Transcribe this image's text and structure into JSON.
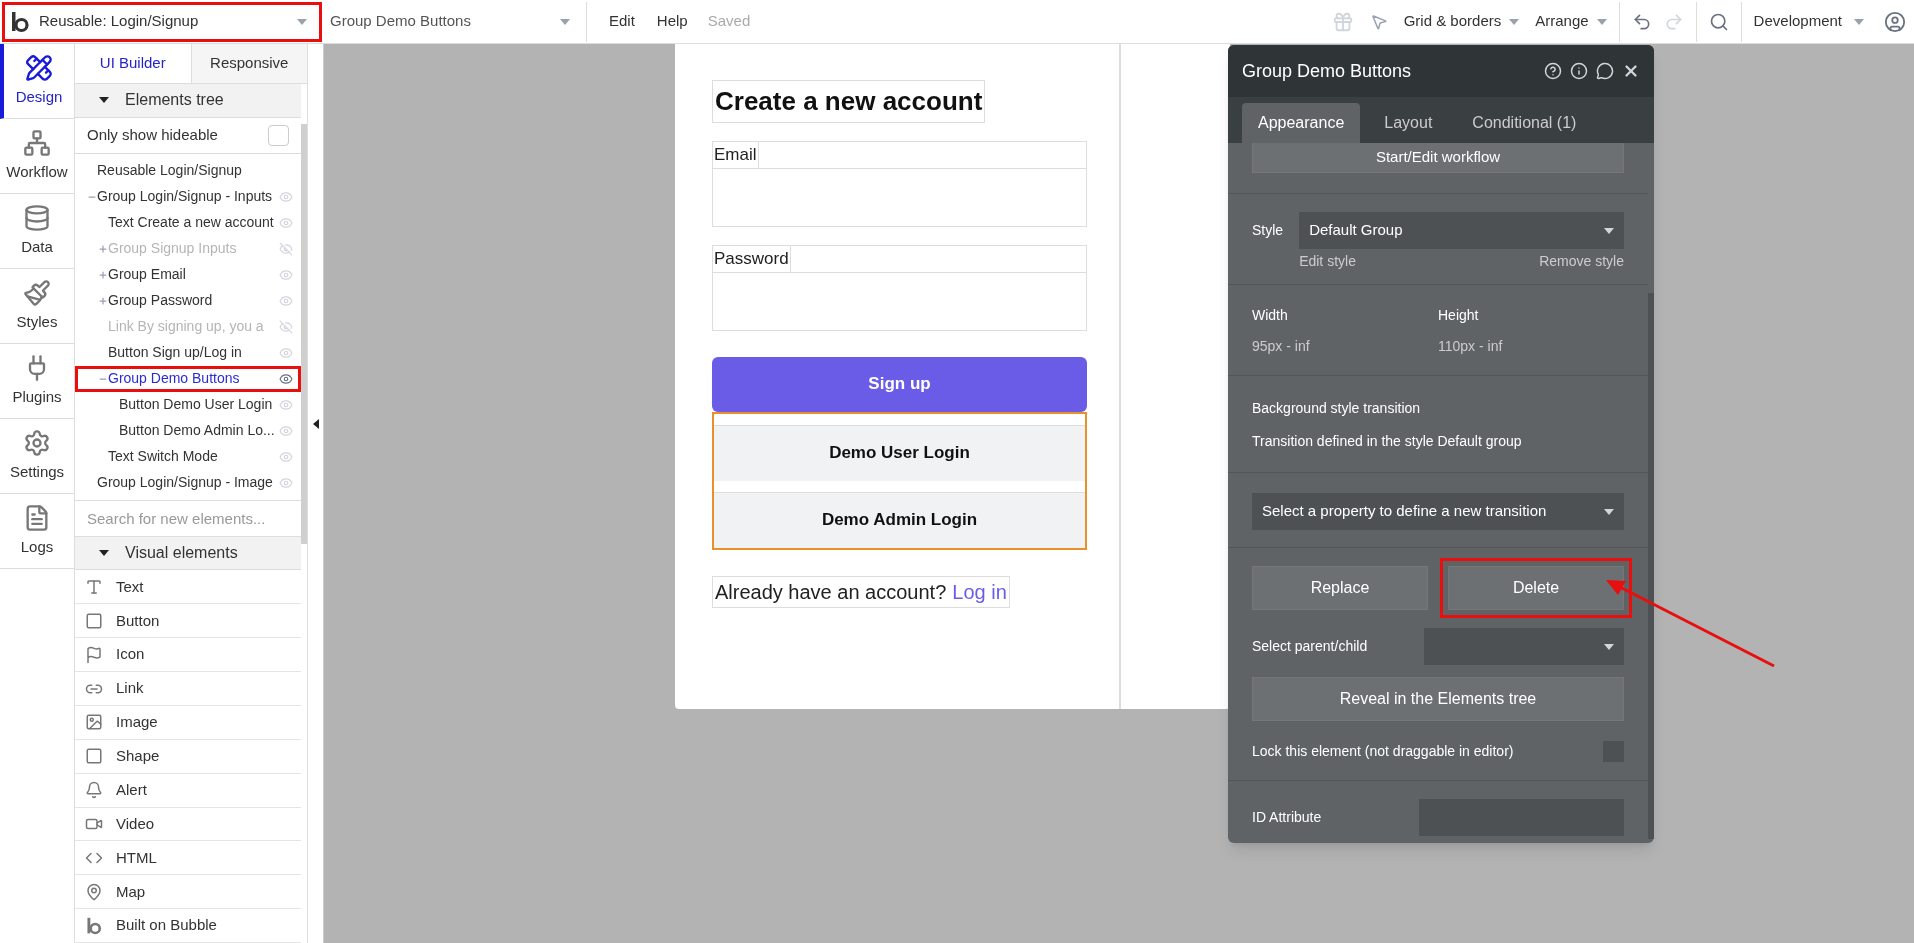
{
  "top_bar": {
    "page_select": {
      "value": "Reusable: Login/Signup",
      "highlighted": true
    },
    "element_select": {
      "value": "Group Demo Buttons"
    },
    "menu": [
      {
        "label": "Edit"
      },
      {
        "label": "Help"
      }
    ],
    "save_status": "Saved",
    "grid_menu": "Grid & borders",
    "arrange_menu": "Arrange",
    "environment": "Development"
  },
  "nav": [
    {
      "label": "Design",
      "selected": true
    },
    {
      "label": "Workflow",
      "selected": false
    },
    {
      "label": "Data",
      "selected": false
    },
    {
      "label": "Styles",
      "selected": false
    },
    {
      "label": "Plugins",
      "selected": false
    },
    {
      "label": "Settings",
      "selected": false
    },
    {
      "label": "Logs",
      "selected": false
    }
  ],
  "panel_tabs": [
    {
      "label": "UI Builder",
      "selected": true
    },
    {
      "label": "Responsive",
      "selected": false
    }
  ],
  "elements_tree": {
    "title": "Elements tree",
    "expanded": true,
    "filter": {
      "label": "Only show hideable",
      "checked": false
    },
    "items": [
      {
        "label": "Reusable Login/Signup",
        "kind": "root",
        "hidden": false,
        "selected": false,
        "highlighted": false
      },
      {
        "label": "Group Login/Signup - Inputs",
        "kind": "element",
        "hidden": false,
        "selected": false,
        "highlighted": false,
        "expanded": true,
        "children": [
          {
            "label": "Text Create a new account",
            "kind": "element",
            "hidden": false,
            "selected": false,
            "highlighted": false
          },
          {
            "label": "Group Signup Inputs",
            "kind": "element",
            "hidden": true,
            "selected": false,
            "highlighted": false,
            "expanded": false
          },
          {
            "label": "Group Email",
            "kind": "element",
            "hidden": false,
            "selected": false,
            "highlighted": false,
            "expanded": false
          },
          {
            "label": "Group Password",
            "kind": "element",
            "hidden": false,
            "selected": false,
            "highlighted": false,
            "expanded": false
          },
          {
            "label": "Link By signing up, you a",
            "kind": "element",
            "hidden": true,
            "selected": false,
            "highlighted": false
          },
          {
            "label": "Button Sign up/Log in",
            "kind": "element",
            "hidden": false,
            "selected": false,
            "highlighted": false
          },
          {
            "label": "Group Demo Buttons",
            "kind": "element",
            "hidden": false,
            "selected": true,
            "highlighted": true,
            "expanded": true,
            "children": [
              {
                "label": "Button Demo User Login",
                "kind": "element",
                "hidden": false,
                "selected": false,
                "highlighted": false
              },
              {
                "label": "Button Demo Admin Lo...",
                "kind": "element",
                "hidden": false,
                "selected": false,
                "highlighted": false
              }
            ]
          },
          {
            "label": "Text Switch Mode",
            "kind": "element",
            "hidden": false,
            "selected": false,
            "highlighted": false
          }
        ]
      },
      {
        "label": "Group Login/Signup - Image",
        "kind": "element",
        "hidden": false,
        "selected": false,
        "highlighted": false
      }
    ]
  },
  "search": {
    "placeholder": "Search for new elements..."
  },
  "visual_elements": {
    "title": "Visual elements",
    "expanded": true,
    "items": [
      {
        "label": "Text"
      },
      {
        "label": "Button"
      },
      {
        "label": "Icon"
      },
      {
        "label": "Link"
      },
      {
        "label": "Image"
      },
      {
        "label": "Shape"
      },
      {
        "label": "Alert"
      },
      {
        "label": "Video"
      },
      {
        "label": "HTML"
      },
      {
        "label": "Map"
      },
      {
        "label": "Built on Bubble"
      }
    ]
  },
  "canvas": {
    "heading": "Create a new account",
    "fields": [
      {
        "label": "Email"
      },
      {
        "label": "Password"
      }
    ],
    "primary_button": "Sign up",
    "demo_group": {
      "selected": true,
      "buttons": [
        {
          "label": "Demo User Login"
        },
        {
          "label": "Demo Admin Login"
        }
      ]
    },
    "footer": {
      "text": "Already have an account?",
      "link": "Log in"
    }
  },
  "property_panel": {
    "title": "Group Demo Buttons",
    "tabs": [
      {
        "label": "Appearance",
        "selected": true
      },
      {
        "label": "Layout",
        "selected": false
      },
      {
        "label": "Conditional (1)",
        "selected": false
      }
    ],
    "workflow_button": "Start/Edit workflow",
    "style": {
      "label": "Style",
      "value": "Default Group",
      "edit": "Edit style",
      "remove": "Remove style"
    },
    "size": [
      {
        "label": "Width",
        "value": "95px - inf"
      },
      {
        "label": "Height",
        "value": "110px - inf"
      }
    ],
    "transition": {
      "title": "Background style transition",
      "note": "Transition defined in the style Default group",
      "select": "Select a property to define a new transition"
    },
    "actions": [
      {
        "label": "Replace",
        "highlighted": false
      },
      {
        "label": "Delete",
        "highlighted": true
      }
    ],
    "parent_select": {
      "label": "Select parent/child"
    },
    "reveal_button": "Reveal in the Elements tree",
    "lock": {
      "label": "Lock this element (not draggable in editor)",
      "checked": false
    },
    "id_attribute": {
      "label": "ID Attribute"
    }
  }
}
